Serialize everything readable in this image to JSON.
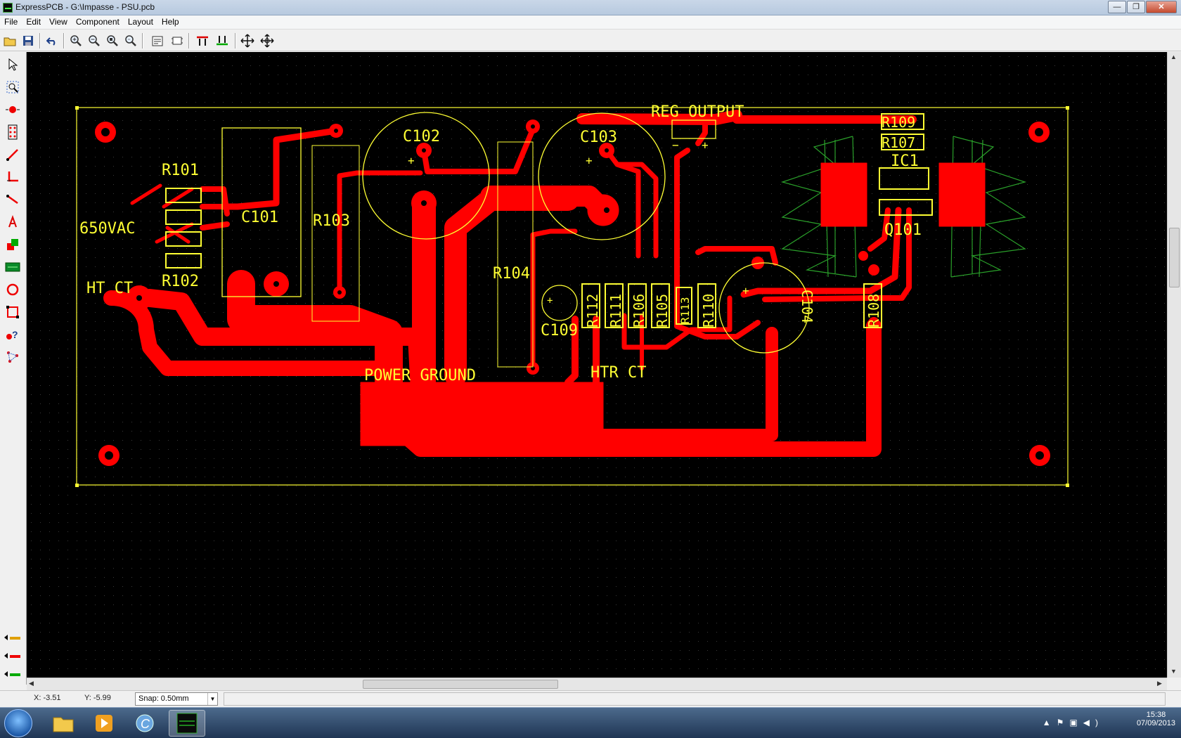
{
  "window": {
    "title": "ExpressPCB - G:\\Impasse - PSU.pcb",
    "buttons": {
      "minimize": "—",
      "maximize": "❐",
      "close": "✕"
    }
  },
  "menu": [
    "File",
    "Edit",
    "View",
    "Component",
    "Layout",
    "Help"
  ],
  "toolbar": {
    "icons": [
      "open-icon",
      "save-icon",
      "undo-icon",
      "zoom-in-icon",
      "zoom-out-icon",
      "zoom-fit-icon",
      "zoom-window-icon",
      "properties-icon",
      "component-icon",
      "top-layer-icon",
      "bottom-layer-icon",
      "move-icon",
      "rotate-icon"
    ]
  },
  "tools": [
    "pointer-tool",
    "zoom-select-tool",
    "pad-tool",
    "component-tool",
    "trace-tool",
    "corner-tool",
    "line-tool",
    "text-tool",
    "layer-tool",
    "silkscreen-tool",
    "circle-tool",
    "rectangle-tool",
    "help-tool",
    "ratsnest-tool"
  ],
  "colors": {
    "copper": "#ff0000",
    "silkscreen": "#ffff33",
    "board_bg": "#000000",
    "heatsink": "#2aa02a"
  },
  "pcb_labels": {
    "r101": "R101",
    "r102": "R102",
    "vac": "650VAC",
    "htct": "HT CT",
    "c101": "C101",
    "r103": "R103",
    "c102": "C102",
    "c103": "C103",
    "reg_output": "REG OUTPUT",
    "r104": "R104",
    "c109": "C109",
    "r112": "R112",
    "r111": "R111",
    "r106": "R106",
    "r105": "R105",
    "r113": "R113",
    "r110": "R110",
    "c104": "C104",
    "power_ground": "POWER GROUND",
    "htr_ct": "HTR CT",
    "r109": "R109",
    "r107": "R107",
    "ic1": "IC1",
    "q101": "Q101",
    "r108": "R108",
    "plus": "+",
    "minus": "−"
  },
  "status": {
    "x": "X: -3.51",
    "y": "Y: -5.99",
    "snap": "Snap: 0.50mm"
  },
  "taskbar": {
    "time": "15:38",
    "date": "07/09/2013"
  }
}
